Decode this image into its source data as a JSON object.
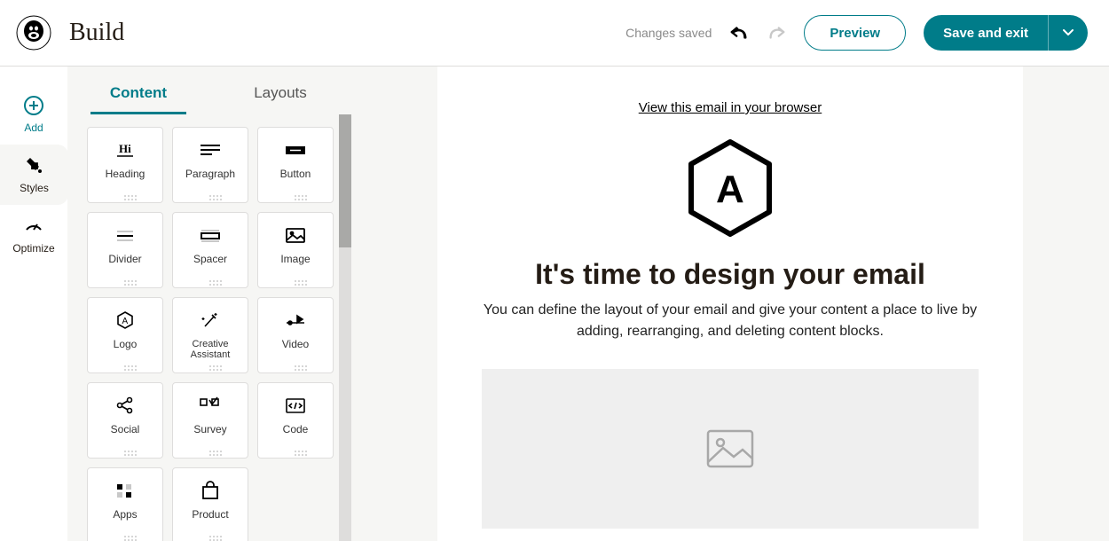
{
  "header": {
    "title": "Build",
    "status": "Changes saved",
    "preview_label": "Preview",
    "save_label": "Save and exit"
  },
  "rail": {
    "add": "Add",
    "styles": "Styles",
    "optimize": "Optimize"
  },
  "tabs": {
    "content": "Content",
    "layouts": "Layouts"
  },
  "blocks": [
    {
      "name": "heading",
      "label": "Heading"
    },
    {
      "name": "paragraph",
      "label": "Paragraph"
    },
    {
      "name": "button",
      "label": "Button"
    },
    {
      "name": "divider",
      "label": "Divider"
    },
    {
      "name": "spacer",
      "label": "Spacer"
    },
    {
      "name": "image",
      "label": "Image"
    },
    {
      "name": "logo",
      "label": "Logo"
    },
    {
      "name": "creative",
      "label": "Creative Assistant"
    },
    {
      "name": "video",
      "label": "Video"
    },
    {
      "name": "social",
      "label": "Social"
    },
    {
      "name": "survey",
      "label": "Survey"
    },
    {
      "name": "code",
      "label": "Code"
    },
    {
      "name": "apps",
      "label": "Apps"
    },
    {
      "name": "product",
      "label": "Product"
    }
  ],
  "canvas": {
    "view_link": "View this email in your browser",
    "headline": "It's time to design your email",
    "body": "You can define the layout of your email and give your content a place to live by adding, rearranging, and deleting content blocks."
  }
}
